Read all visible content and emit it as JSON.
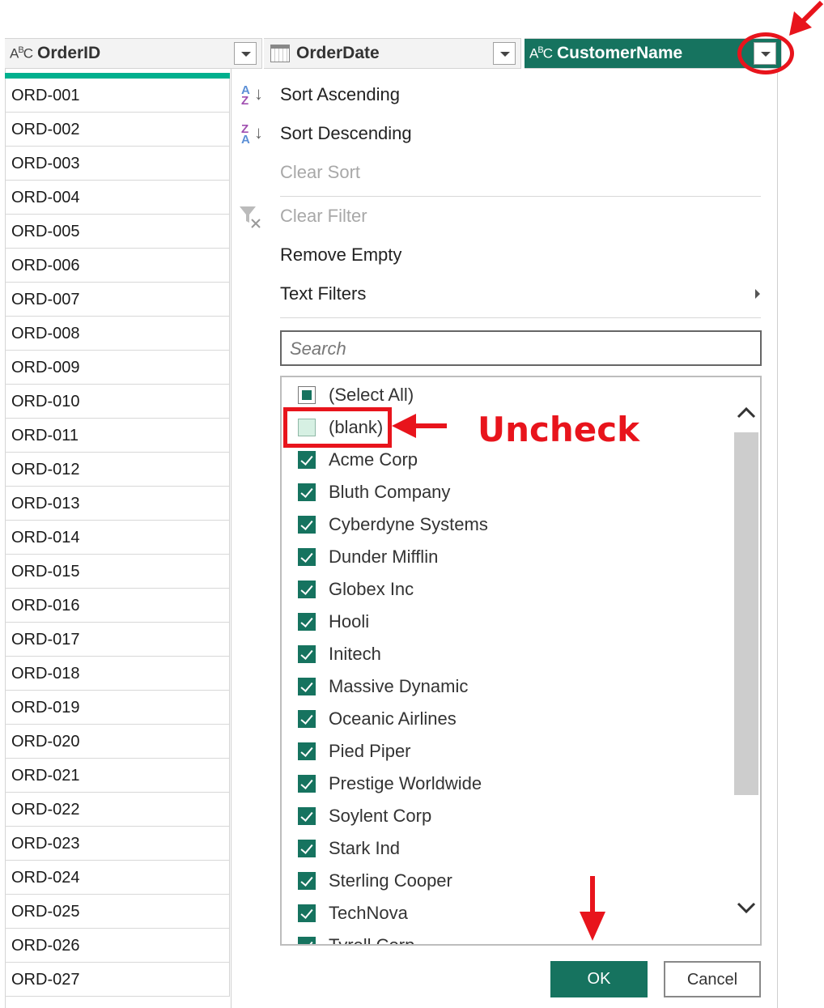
{
  "columns": [
    {
      "name": "OrderID",
      "type_icon": "ABC"
    },
    {
      "name": "OrderDate",
      "type_icon": "calendar-icon"
    },
    {
      "name": "CustomerName",
      "type_icon": "ABC"
    }
  ],
  "rows": [
    "ORD-001",
    "ORD-002",
    "ORD-003",
    "ORD-004",
    "ORD-005",
    "ORD-006",
    "ORD-007",
    "ORD-008",
    "ORD-009",
    "ORD-010",
    "ORD-011",
    "ORD-012",
    "ORD-013",
    "ORD-014",
    "ORD-015",
    "ORD-016",
    "ORD-017",
    "ORD-018",
    "ORD-019",
    "ORD-020",
    "ORD-021",
    "ORD-022",
    "ORD-023",
    "ORD-024",
    "ORD-025",
    "ORD-026",
    "ORD-027"
  ],
  "menu": {
    "sort_ascending": "Sort Ascending",
    "sort_descending": "Sort Descending",
    "clear_sort": "Clear Sort",
    "clear_filter": "Clear Filter",
    "remove_empty": "Remove Empty",
    "text_filters": "Text Filters"
  },
  "search": {
    "placeholder": "Search"
  },
  "filter_list": [
    {
      "label": "(Select All)",
      "state": "partial"
    },
    {
      "label": "(blank)",
      "state": "unchecked"
    },
    {
      "label": "Acme Corp",
      "state": "checked"
    },
    {
      "label": "Bluth Company",
      "state": "checked"
    },
    {
      "label": "Cyberdyne Systems",
      "state": "checked"
    },
    {
      "label": "Dunder Mifflin",
      "state": "checked"
    },
    {
      "label": "Globex Inc",
      "state": "checked"
    },
    {
      "label": "Hooli",
      "state": "checked"
    },
    {
      "label": "Initech",
      "state": "checked"
    },
    {
      "label": "Massive Dynamic",
      "state": "checked"
    },
    {
      "label": "Oceanic Airlines",
      "state": "checked"
    },
    {
      "label": "Pied Piper",
      "state": "checked"
    },
    {
      "label": "Prestige Worldwide",
      "state": "checked"
    },
    {
      "label": "Soylent Corp",
      "state": "checked"
    },
    {
      "label": "Stark Ind",
      "state": "checked"
    },
    {
      "label": "Sterling Cooper",
      "state": "checked"
    },
    {
      "label": "TechNova",
      "state": "checked"
    },
    {
      "label": "Tyrell Corp",
      "state": "checked"
    }
  ],
  "buttons": {
    "ok": "OK",
    "cancel": "Cancel"
  },
  "annotation": {
    "text": "Uncheck"
  },
  "colors": {
    "accent": "#16735f",
    "annotation": "#e8141c",
    "active_row_bar": "#00b08e"
  }
}
